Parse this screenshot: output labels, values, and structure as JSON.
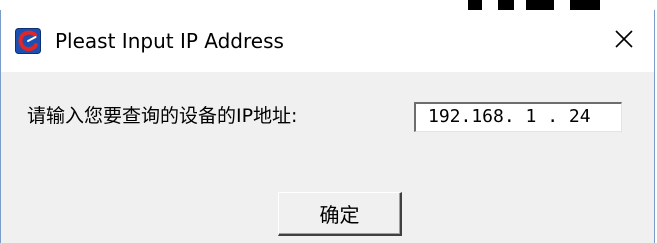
{
  "window": {
    "title": "Pleast Input IP Address",
    "icon": "app-logo-icon",
    "close_icon": "close-icon",
    "frame_color": "#7a9cc8",
    "client_background": "#f0f0f0"
  },
  "form": {
    "prompt_label": "请输入您要查询的设备的IP地址:",
    "ip_value": "192.168. 1 . 24"
  },
  "buttons": {
    "ok_label": "确定"
  }
}
